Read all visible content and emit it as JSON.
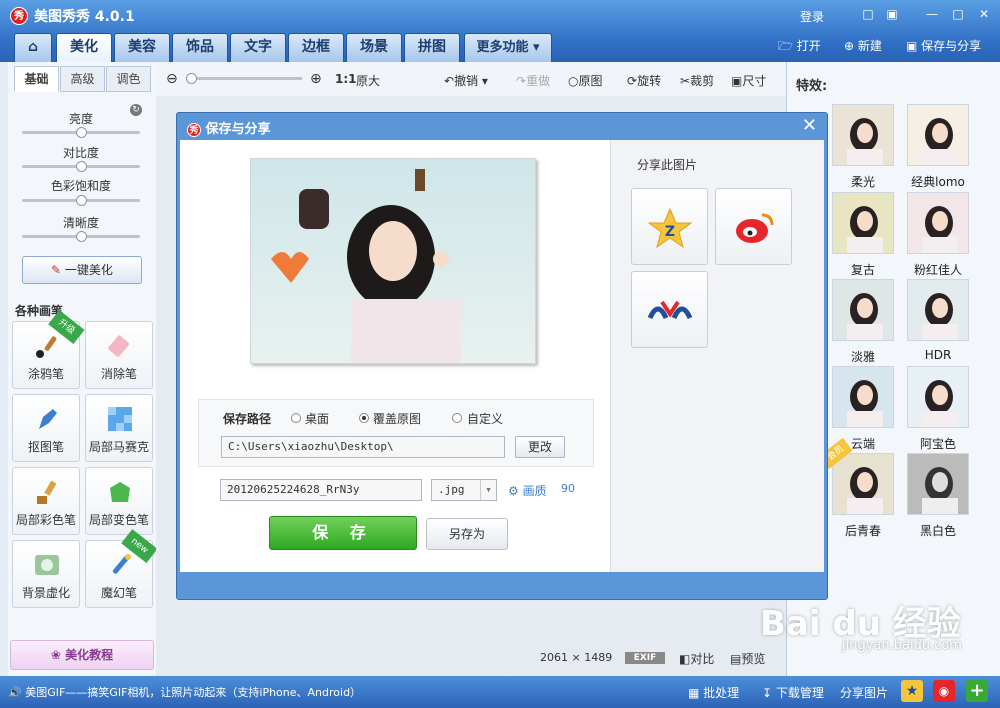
{
  "app": {
    "title": "美图秀秀 4.0.1",
    "logo_char": "秀"
  },
  "titlebar": {
    "login": "登录"
  },
  "tabs": [
    "美化",
    "美容",
    "饰品",
    "文字",
    "边框",
    "场景",
    "拼图",
    "更多功能"
  ],
  "top_right": {
    "open": "打开",
    "new": "新建",
    "save_share": "保存与分享"
  },
  "left": {
    "subtabs": [
      "基础",
      "高级",
      "调色"
    ],
    "sliders": [
      {
        "label": "亮度",
        "value": 0.5
      },
      {
        "label": "对比度",
        "value": 0.5
      },
      {
        "label": "色彩饱和度",
        "value": 0.5
      },
      {
        "label": "清晰度",
        "value": 0.5
      }
    ],
    "one_key": "一键美化",
    "brush_header": "各种画笔",
    "brushes": [
      "涂鸦笔",
      "消除笔",
      "抠图笔",
      "局部马赛克",
      "局部彩色笔",
      "局部变色笔",
      "背景虚化",
      "魔幻笔"
    ],
    "badge_upgrade": "升级",
    "badge_new": "new",
    "tutorial": "美化教程"
  },
  "toolbar": {
    "zoom_ratio": "1:1",
    "original_size": "原大",
    "undo": "撤销",
    "redo": "重做",
    "original": "原图",
    "rotate": "旋转",
    "crop": "裁剪",
    "size": "尺寸"
  },
  "right": {
    "title": "特效:",
    "effects": [
      "柔光",
      "经典lomo",
      "复古",
      "粉红佳人",
      "淡雅",
      "HDR",
      "云端",
      "阿宝色",
      "后青春",
      "黑白色"
    ],
    "badge_hot": "会员"
  },
  "dialog": {
    "title": "保存与分享",
    "share_title": "分享此图片",
    "save_path_label": "保存路径",
    "options": [
      "桌面",
      "覆盖原图",
      "自定义"
    ],
    "selected_option": 1,
    "path_value": "C:\\Users\\xiaozhu\\Desktop\\",
    "change_btn": "更改",
    "filename": "20120625224628_RrN3y",
    "format": ".jpg",
    "quality_label": "画质",
    "quality_value": "90",
    "save_btn": "保 存",
    "saveas_btn": "另存为"
  },
  "bottom": {
    "dims_w": "2061",
    "dims_x": "×",
    "dims_h": "1489",
    "exif": "EXIF",
    "compare": "对比",
    "preview": "预览"
  },
  "status": {
    "message": "美图GIF——搞笑GIF相机，让照片动起来（支持iPhone、Android）",
    "batch": "批处理",
    "download": "下载管理",
    "share_pic": "分享图片"
  },
  "watermark": {
    "logo": "Bai du 经验",
    "url": "jingyan.baidu.com"
  },
  "colors": {
    "accent": "#2f6fc5",
    "save_green": "#2ea821"
  }
}
